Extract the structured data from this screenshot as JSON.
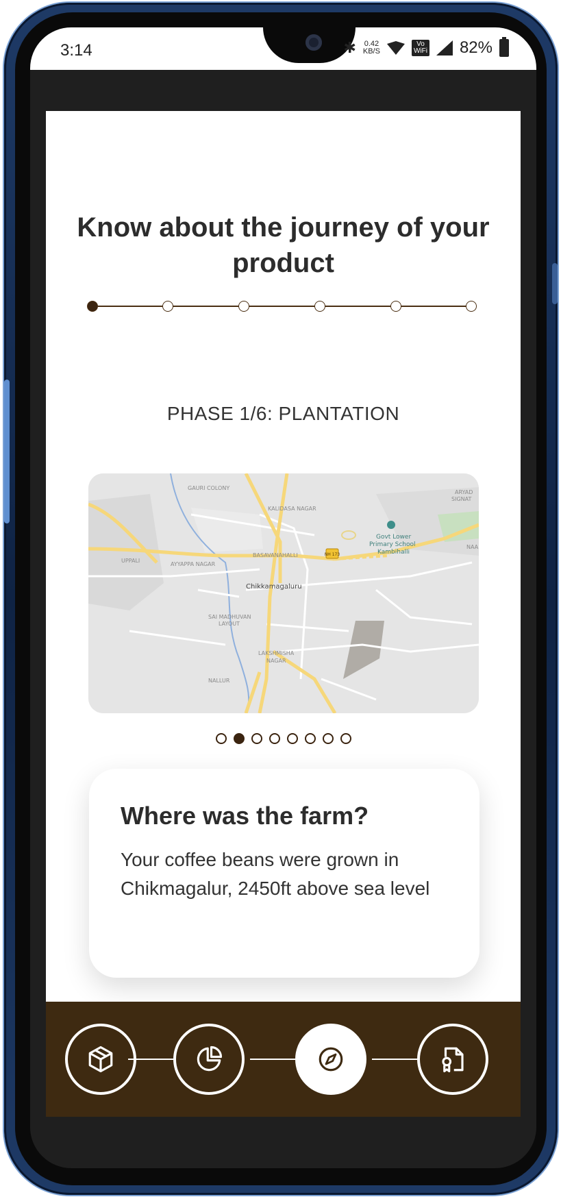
{
  "status_bar": {
    "time": "3:14",
    "net_speed_value": "0.42",
    "net_speed_unit": "KB/S",
    "vowifi_top": "Vo",
    "vowifi_bottom": "WiFi",
    "battery": "82%",
    "icons": [
      "bluetooth-icon",
      "wifi-icon",
      "vowifi-icon",
      "signal-icon",
      "battery-icon"
    ]
  },
  "page": {
    "title": "Know about the journey of your product",
    "phase_label": "PHASE 1/6: PLANTATION",
    "phase_steps": 6,
    "active_phase": 1
  },
  "map": {
    "labels": {
      "gauri_colony": "GAURI COLONY",
      "kalidasa_nagar": "KALIDASA NAGAR",
      "govt_school_1": "Govt Lower",
      "govt_school_2": "Primary School",
      "govt_school_3": "Kambihalli",
      "uppali": "UPPALI",
      "ayyappa_nagar": "AYYAPPA NAGAR",
      "basavanahalli": "BASAVANAHALLI",
      "chikkamagaluru": "Chikkamagaluru",
      "sai_madhuvan_1": "SAI MADHUVAN",
      "sai_madhuvan_2": "LAYOUT",
      "lakshmisha_1": "LAKSHMISHA",
      "lakshmisha_2": "NAGAR",
      "nallur": "NALLUR",
      "aryad_1": "ARYAD",
      "aryad_2": "SIGNAT",
      "naa": "NAA",
      "highway_badge": "NH 173"
    }
  },
  "carousel": {
    "count": 8,
    "active_index": 1
  },
  "info_card": {
    "heading": "Where was the farm?",
    "body": "Your coffee beans were grown in Chikmagalur, 2450ft above sea level"
  },
  "bottom_nav": {
    "items": [
      {
        "name": "product-icon"
      },
      {
        "name": "pie-chart-icon"
      },
      {
        "name": "compass-icon"
      },
      {
        "name": "certificate-icon"
      }
    ],
    "active_index": 2
  },
  "colors": {
    "brand_brown": "#3e2a11",
    "dark_brown": "#3b2410",
    "map_road": "#f6d77a"
  }
}
